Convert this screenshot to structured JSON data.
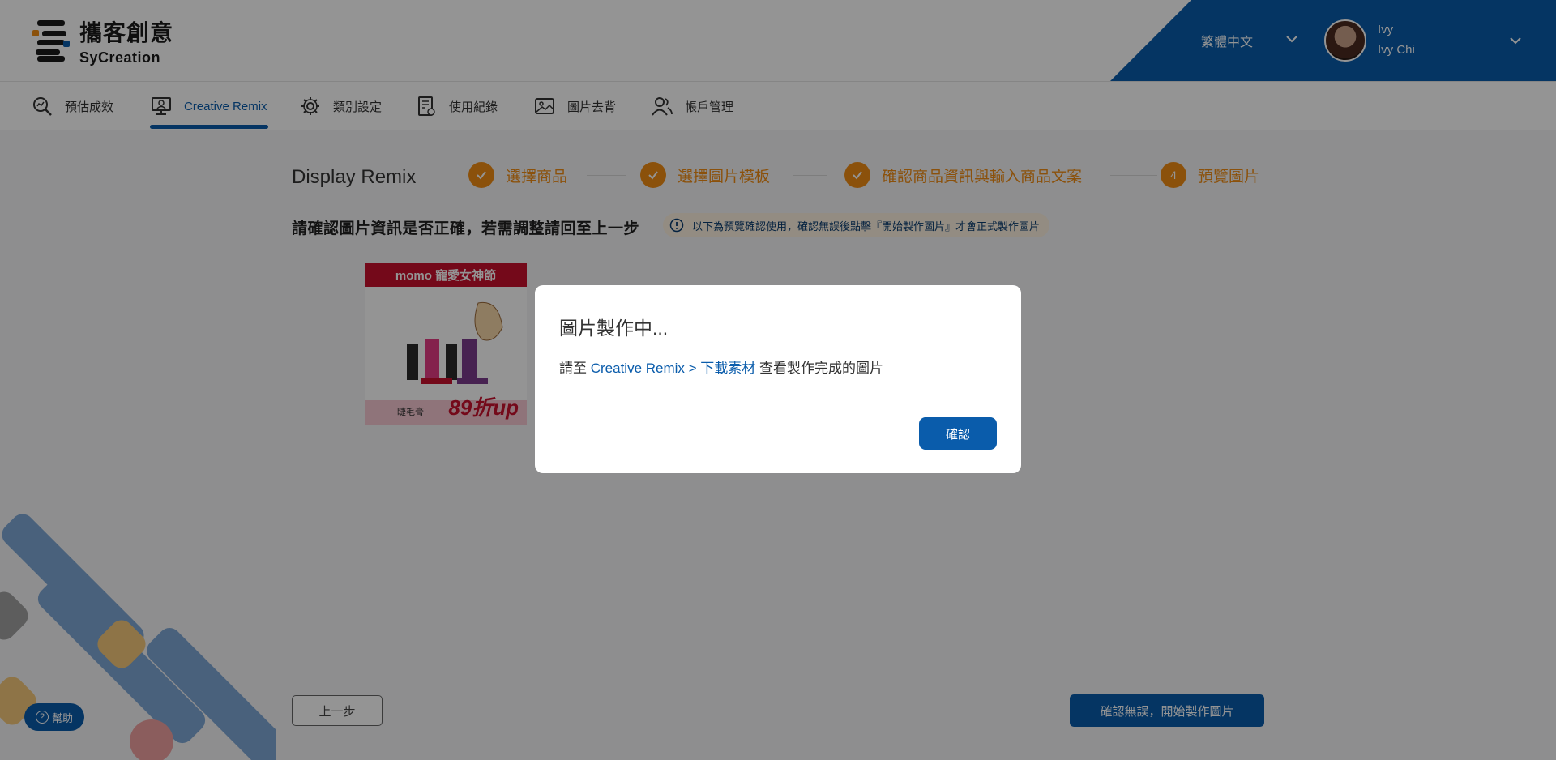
{
  "brand": {
    "name_cn": "攜客創意",
    "name_en": "SyCreation"
  },
  "header": {
    "language": "繁體中文",
    "user_short": "Ivy",
    "user_full": "Ivy Chi"
  },
  "nav": {
    "items": [
      {
        "label": "預估成效",
        "icon": "search-chart-icon"
      },
      {
        "label": "Creative Remix",
        "icon": "monitor-user-icon",
        "active": true
      },
      {
        "label": "類別設定",
        "icon": "gear-icon"
      },
      {
        "label": "使用紀錄",
        "icon": "log-icon"
      },
      {
        "label": "圖片去背",
        "icon": "image-icon"
      },
      {
        "label": "帳戶管理",
        "icon": "users-icon"
      }
    ]
  },
  "page": {
    "title": "Display Remix",
    "steps": [
      {
        "label": "選擇商品",
        "status": "done"
      },
      {
        "label": "選擇圖片模板",
        "status": "done"
      },
      {
        "label": "確認商品資訊與輸入商品文案",
        "status": "done"
      },
      {
        "label": "預覽圖片",
        "status": "current",
        "number": "4"
      }
    ],
    "subtitle": "請確認圖片資訊是否正確，若需調整請回至上一步",
    "notice": "以下為預覽確認使用，確認無誤後點擊『開始製作圖片』才會正式製作圖片",
    "preview": {
      "banner": "momo 寵愛女神節",
      "brand": "睫毛膏",
      "price": "89折up"
    },
    "prev_button": "上一步",
    "confirm_button": "確認無誤，開始製作圖片"
  },
  "help": {
    "label": "幫助"
  },
  "modal": {
    "title": "圖片製作中...",
    "msg_prefix": "請至",
    "msg_link": "Creative Remix > 下載素材",
    "msg_suffix": "查看製作完成的圖片",
    "button": "確認"
  },
  "colors": {
    "primary": "#0a5cab",
    "accent": "#f08c14"
  }
}
